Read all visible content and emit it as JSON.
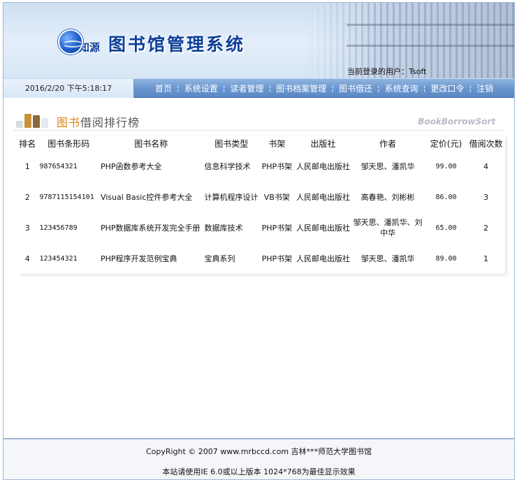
{
  "header": {
    "brand": "知源",
    "title": "图书馆管理系统",
    "current_user_label": "当前登录的用户：",
    "current_user": "Tsoft"
  },
  "nav": {
    "datetime": "2016/2/20 下午5:18:17",
    "items": [
      "首页",
      "系统设置",
      "读者管理",
      "图书档案管理",
      "图书借还",
      "系统查询",
      "更改口令",
      "注销"
    ]
  },
  "section": {
    "title_accent": "图书",
    "title_rest": "借阅排行榜",
    "title_en": "BookBorrowSort"
  },
  "table": {
    "headers": [
      "排名",
      "图书条形码",
      "图书名称",
      "图书类型",
      "书架",
      "出版社",
      "作者",
      "定价(元)",
      "借阅次数"
    ],
    "rows": [
      [
        "1",
        "987654321",
        "PHP函数参考大全",
        "信息科学技术",
        "PHP书架",
        "人民邮电出版社",
        "邹天思、潘凯华",
        "99.00",
        "4"
      ],
      [
        "2",
        "9787115154101",
        "Visual Basic控件参考大全",
        "计算机程序设计",
        "VB书架",
        "人民邮电出版社",
        "高春艳、刘彬彬",
        "86.00",
        "3"
      ],
      [
        "3",
        "123456789",
        "PHP数据库系统开发完全手册",
        "数据库技术",
        "PHP书架",
        "人民邮电出版社",
        "邹天思、潘凯华、刘中华",
        "65.00",
        "2"
      ],
      [
        "4",
        "123454321",
        "PHP程序开发范例宝典",
        "宝典系列",
        "PHP书架",
        "人民邮电出版社",
        "邹天思、潘凯华",
        "89.00",
        "1"
      ]
    ]
  },
  "footer": {
    "copyright": "CopyRight © 2007 www.mrbccd.com  吉林***师范大学图书馆",
    "note": "本站请使用IE 6.0或以上版本 1024*768为最佳显示效果"
  },
  "colors": {
    "nav_bar": "#6b97cf",
    "brand_blue": "#0d3f99",
    "accent_orange": "#e0861a"
  }
}
